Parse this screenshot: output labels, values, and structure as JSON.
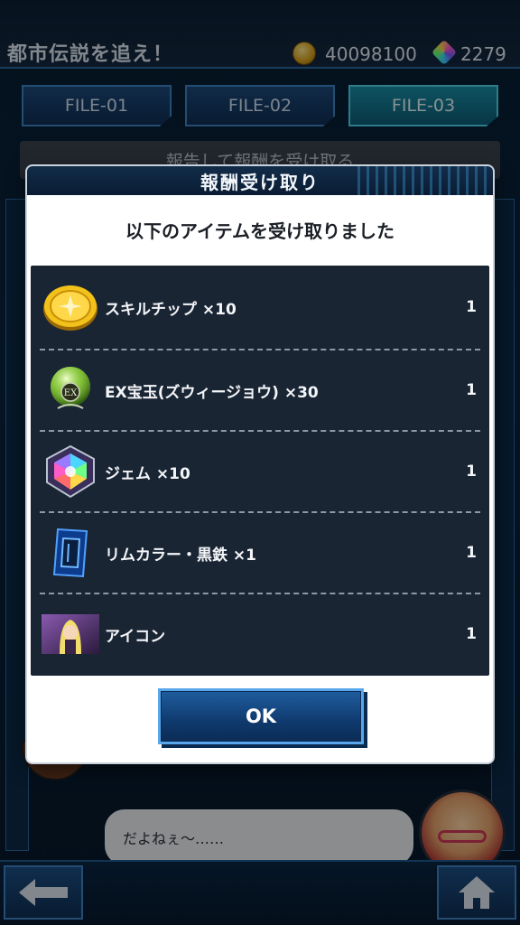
{
  "header": {
    "title": "都市伝説を追え！",
    "coins": "40098100",
    "gems": "2279"
  },
  "tabs": [
    {
      "label": "FILE-01",
      "active": false
    },
    {
      "label": "FILE-02",
      "active": false
    },
    {
      "label": "FILE-03",
      "active": true
    }
  ],
  "report_bar": {
    "label": "報告して報酬を受け取る"
  },
  "chat": {
    "message": "だよねぇ〜……"
  },
  "modal": {
    "title": "報酬受け取り",
    "message": "以下のアイテムを受け取りました",
    "items": [
      {
        "name": "スキルチップ ×10",
        "qty": "1",
        "icon": "skill-chip-icon"
      },
      {
        "name": "EX宝玉(ズウィージョウ) ×30",
        "qty": "1",
        "icon": "ex-orb-icon"
      },
      {
        "name": "ジェム ×10",
        "qty": "1",
        "icon": "gem-icon"
      },
      {
        "name": "リムカラー・黒鉄 ×1",
        "qty": "1",
        "icon": "rim-color-icon"
      },
      {
        "name": "アイコン",
        "qty": "1",
        "icon": "avatar-icon"
      }
    ],
    "ok_label": "OK"
  },
  "colors": {
    "accent": "#3f86c6",
    "active_tab": "#1a8fa8",
    "list_bg": "#1a2534"
  }
}
